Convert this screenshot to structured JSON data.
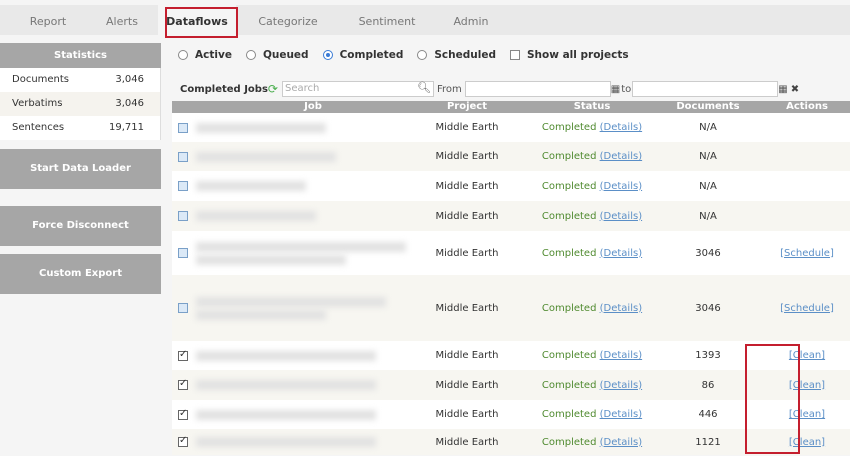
{
  "tabs": [
    {
      "label": "Report",
      "active": false
    },
    {
      "label": "Alerts",
      "active": false
    },
    {
      "label": "Dataflows",
      "active": true
    },
    {
      "label": "Categorize",
      "active": false
    },
    {
      "label": "Sentiment",
      "active": false
    },
    {
      "label": "Admin",
      "active": false
    }
  ],
  "statistics": {
    "title": "Statistics",
    "rows": [
      {
        "label": "Documents",
        "value": "3,046"
      },
      {
        "label": "Verbatims",
        "value": "3,046"
      },
      {
        "label": "Sentences",
        "value": "19,711"
      }
    ]
  },
  "sidebar_buttons": [
    "Start Data Loader",
    "Force Disconnect",
    "Custom Export"
  ],
  "filters": {
    "options": [
      {
        "label": "Active",
        "selected": false
      },
      {
        "label": "Queued",
        "selected": false
      },
      {
        "label": "Completed",
        "selected": true
      },
      {
        "label": "Scheduled",
        "selected": false
      }
    ],
    "show_all": {
      "label": "Show all projects",
      "checked": false
    }
  },
  "toolbar": {
    "title": "Completed Jobs",
    "search_placeholder": "Search",
    "from_label": "From",
    "to_label": "to",
    "from_value": "",
    "to_value": ""
  },
  "table": {
    "headers": [
      "Job",
      "Project",
      "Status",
      "Documents",
      "Actions"
    ],
    "rows": [
      {
        "checked": false,
        "project": "Middle Earth",
        "status": "Completed",
        "details": "(Details)",
        "documents": "N/A",
        "action": ""
      },
      {
        "checked": false,
        "project": "Middle Earth",
        "status": "Completed",
        "details": "(Details)",
        "documents": "N/A",
        "action": ""
      },
      {
        "checked": false,
        "project": "Middle Earth",
        "status": "Completed",
        "details": "(Details)",
        "documents": "N/A",
        "action": ""
      },
      {
        "checked": false,
        "project": "Middle Earth",
        "status": "Completed",
        "details": "(Details)",
        "documents": "N/A",
        "action": ""
      },
      {
        "checked": false,
        "project": "Middle Earth",
        "status": "Completed",
        "details": "(Details)",
        "documents": "3046",
        "action": "[Schedule]"
      },
      {
        "checked": false,
        "project": "Middle Earth",
        "status": "Completed",
        "details": "(Details)",
        "documents": "3046",
        "action": "[Schedule]"
      },
      {
        "checked": true,
        "project": "Middle Earth",
        "status": "Completed",
        "details": "(Details)",
        "documents": "1393",
        "action": "[Clean]"
      },
      {
        "checked": true,
        "project": "Middle Earth",
        "status": "Completed",
        "details": "(Details)",
        "documents": "86",
        "action": "[Clean]"
      },
      {
        "checked": true,
        "project": "Middle Earth",
        "status": "Completed",
        "details": "(Details)",
        "documents": "446",
        "action": "[Clean]"
      },
      {
        "checked": true,
        "project": "Middle Earth",
        "status": "Completed",
        "details": "(Details)",
        "documents": "1121",
        "action": "[Clean]"
      }
    ]
  },
  "colors": {
    "highlight": "#c41e2e",
    "status": "#4f8a2f",
    "link": "#5b8fc7",
    "header": "#a6a6a6"
  }
}
